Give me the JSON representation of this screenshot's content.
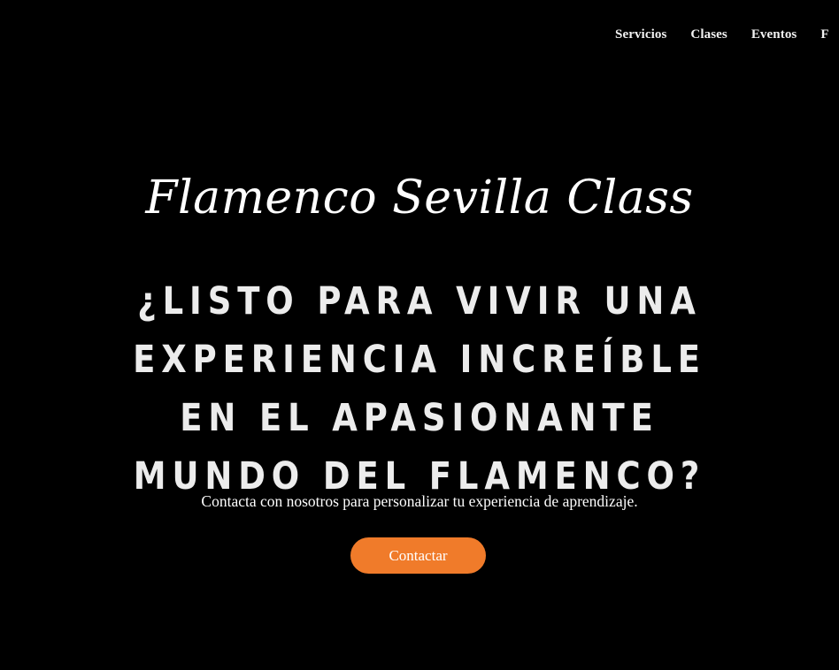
{
  "nav": {
    "items": [
      {
        "label": "Servicios"
      },
      {
        "label": "Clases"
      },
      {
        "label": "Eventos"
      },
      {
        "label": "F"
      }
    ]
  },
  "hero": {
    "brand": "Flamenco Sevilla Class",
    "headline": "¿LISTO PARA VIVIR UNA EXPERIENCIA INCREÍBLE EN EL APASIONANTE MUNDO DEL FLAMENCO?",
    "subtext": "Contacta con nosotros para personalizar tu experiencia de aprendizaje.",
    "cta_label": "Contactar"
  },
  "colors": {
    "background": "#000000",
    "accent": "#f07b2a",
    "text": "#ffffff"
  }
}
